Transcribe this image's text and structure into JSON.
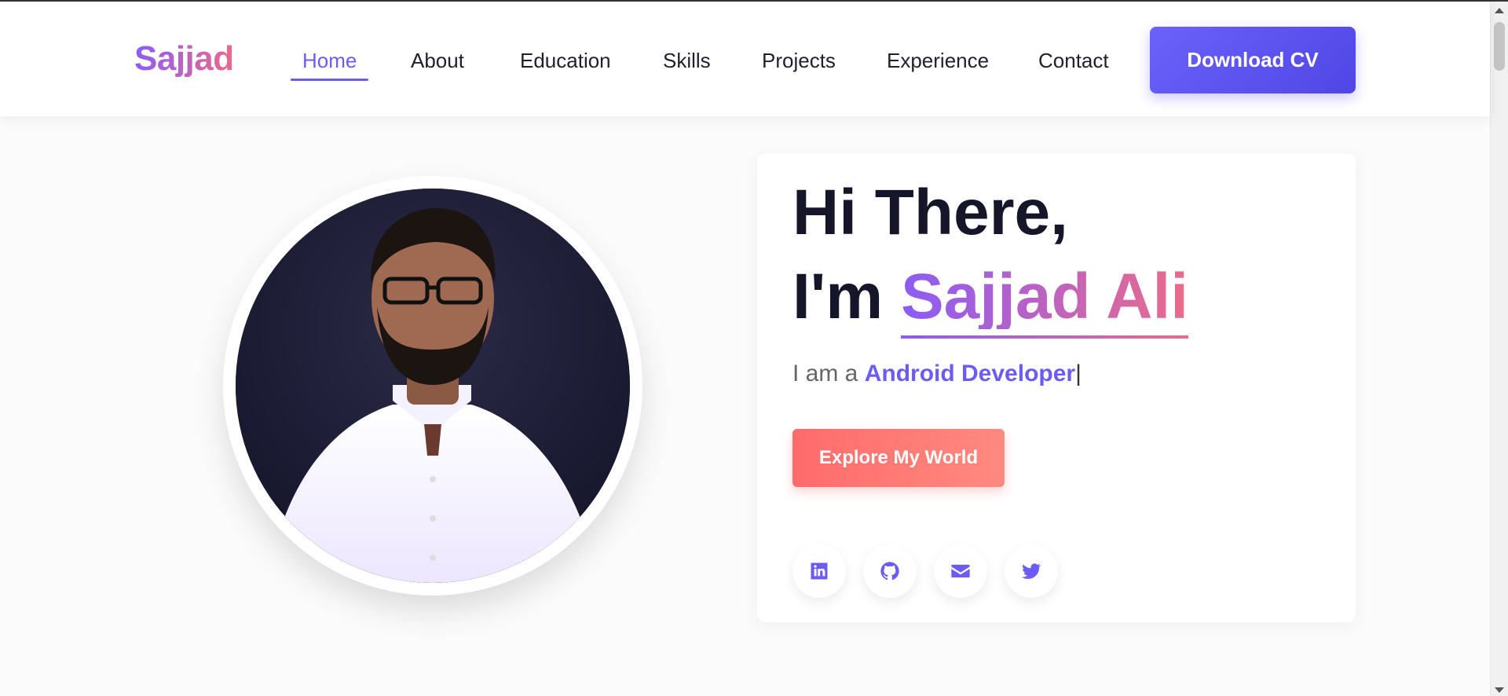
{
  "header": {
    "logo": "Sajjad",
    "nav": [
      {
        "label": "Home",
        "active": true
      },
      {
        "label": "About",
        "active": false
      },
      {
        "label": "Education",
        "active": false
      },
      {
        "label": "Skills",
        "active": false
      },
      {
        "label": "Projects",
        "active": false
      },
      {
        "label": "Experience",
        "active": false
      },
      {
        "label": "Contact",
        "active": false
      }
    ],
    "cta_label": "Download CV"
  },
  "hero": {
    "greeting": "Hi There,",
    "im_prefix": "I'm ",
    "name": "Sajjad Ali",
    "role_prefix": "I am a ",
    "role": "Android Developer",
    "cursor": "|",
    "explore_label": "Explore My World",
    "social": [
      {
        "icon": "linkedin-icon"
      },
      {
        "icon": "github-icon"
      },
      {
        "icon": "email-icon"
      },
      {
        "icon": "twitter-icon"
      }
    ]
  },
  "colors": {
    "accent": "#6b5cf6",
    "gradient_start": "#8b5cf6",
    "gradient_end": "#ec6a8a",
    "cta_button": "#5a52f0",
    "explore_button": "#ff6b6b"
  }
}
